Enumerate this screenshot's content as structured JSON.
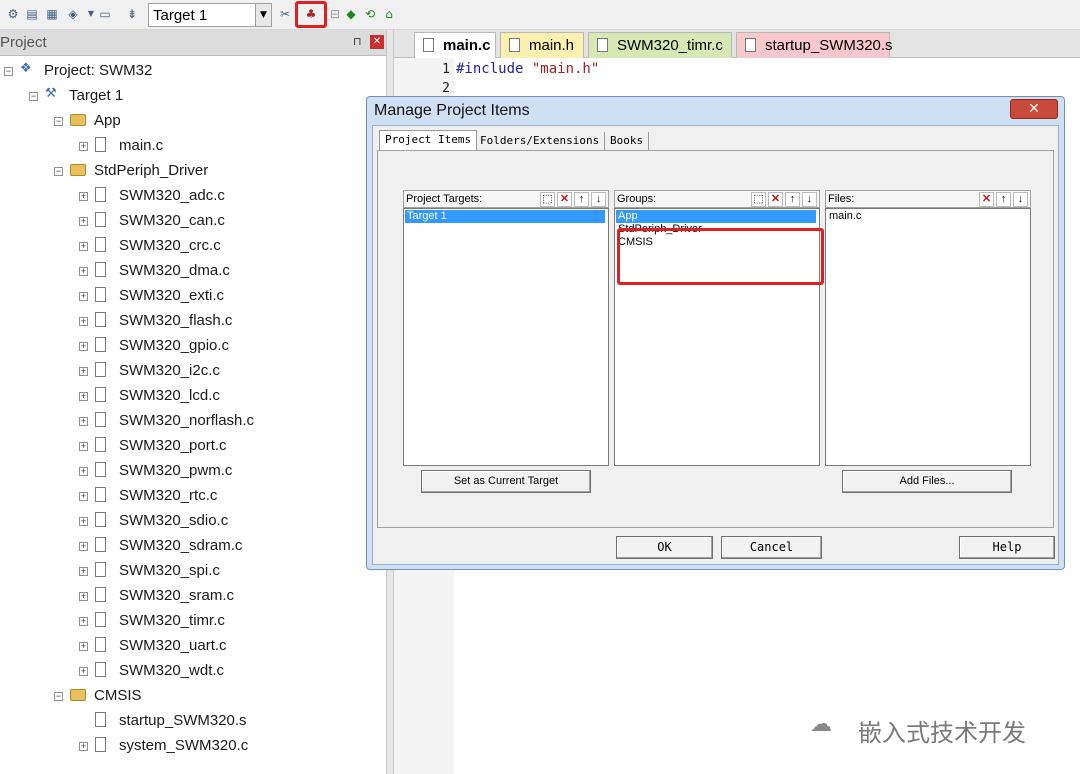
{
  "toolbar": {
    "target_value": "Target 1",
    "icons": [
      "translate-icon",
      "build-icon",
      "rebuild-icon",
      "batch-build-icon",
      "download-icon",
      "options-icon",
      "manage-project-items-icon",
      "select-packs-icon",
      "manage-rte-icon"
    ]
  },
  "project_panel": {
    "title": "Project",
    "tree": [
      {
        "label": "Project: SWM32",
        "level": 0,
        "kind": "project"
      },
      {
        "label": "Target 1",
        "level": 1,
        "kind": "target"
      },
      {
        "label": "App",
        "level": 2,
        "kind": "folder"
      },
      {
        "label": "main.c",
        "level": 3,
        "kind": "file"
      },
      {
        "label": "StdPeriph_Driver",
        "level": 2,
        "kind": "folder"
      },
      {
        "label": "SWM320_adc.c",
        "level": 3,
        "kind": "file"
      },
      {
        "label": "SWM320_can.c",
        "level": 3,
        "kind": "file"
      },
      {
        "label": "SWM320_crc.c",
        "level": 3,
        "kind": "file"
      },
      {
        "label": "SWM320_dma.c",
        "level": 3,
        "kind": "file"
      },
      {
        "label": "SWM320_exti.c",
        "level": 3,
        "kind": "file"
      },
      {
        "label": "SWM320_flash.c",
        "level": 3,
        "kind": "file"
      },
      {
        "label": "SWM320_gpio.c",
        "level": 3,
        "kind": "file"
      },
      {
        "label": "SWM320_i2c.c",
        "level": 3,
        "kind": "file"
      },
      {
        "label": "SWM320_lcd.c",
        "level": 3,
        "kind": "file"
      },
      {
        "label": "SWM320_norflash.c",
        "level": 3,
        "kind": "file"
      },
      {
        "label": "SWM320_port.c",
        "level": 3,
        "kind": "file"
      },
      {
        "label": "SWM320_pwm.c",
        "level": 3,
        "kind": "file"
      },
      {
        "label": "SWM320_rtc.c",
        "level": 3,
        "kind": "file"
      },
      {
        "label": "SWM320_sdio.c",
        "level": 3,
        "kind": "file"
      },
      {
        "label": "SWM320_sdram.c",
        "level": 3,
        "kind": "file"
      },
      {
        "label": "SWM320_spi.c",
        "level": 3,
        "kind": "file"
      },
      {
        "label": "SWM320_sram.c",
        "level": 3,
        "kind": "file"
      },
      {
        "label": "SWM320_timr.c",
        "level": 3,
        "kind": "file"
      },
      {
        "label": "SWM320_uart.c",
        "level": 3,
        "kind": "file"
      },
      {
        "label": "SWM320_wdt.c",
        "level": 3,
        "kind": "file"
      },
      {
        "label": "CMSIS",
        "level": 2,
        "kind": "folder"
      },
      {
        "label": "startup_SWM320.s",
        "level": 3,
        "kind": "file"
      },
      {
        "label": "system_SWM320.c",
        "level": 3,
        "kind": "file"
      }
    ]
  },
  "editor": {
    "tabs": [
      {
        "label": "main.c",
        "active": true,
        "color": "white"
      },
      {
        "label": "main.h",
        "active": false,
        "color": "yellow"
      },
      {
        "label": "SWM320_timr.c",
        "active": false,
        "color": "green"
      },
      {
        "label": "startup_SWM320.s",
        "active": false,
        "color": "pink"
      }
    ],
    "line_numbers": [
      "1",
      "2"
    ],
    "code": {
      "directive": "#include ",
      "string": "\"main.h\""
    }
  },
  "dialog": {
    "title": "Manage Project Items",
    "close_label": "✕",
    "tabs": [
      "Project Items",
      "Folders/Extensions",
      "Books"
    ],
    "targets": {
      "header": "Project Targets:",
      "items": [
        "Target 1"
      ],
      "selected": 0
    },
    "groups": {
      "header": "Groups:",
      "items": [
        "App",
        "StdPeriph_Driver",
        "CMSIS"
      ],
      "selected": 0
    },
    "files": {
      "header": "Files:",
      "items": [
        "main.c"
      ]
    },
    "set_current_target_label": "Set as Current Target",
    "add_files_label": "Add Files...",
    "ok_label": "OK",
    "cancel_label": "Cancel",
    "help_label": "Help"
  },
  "watermark": {
    "text": "嵌入式技术开发"
  }
}
